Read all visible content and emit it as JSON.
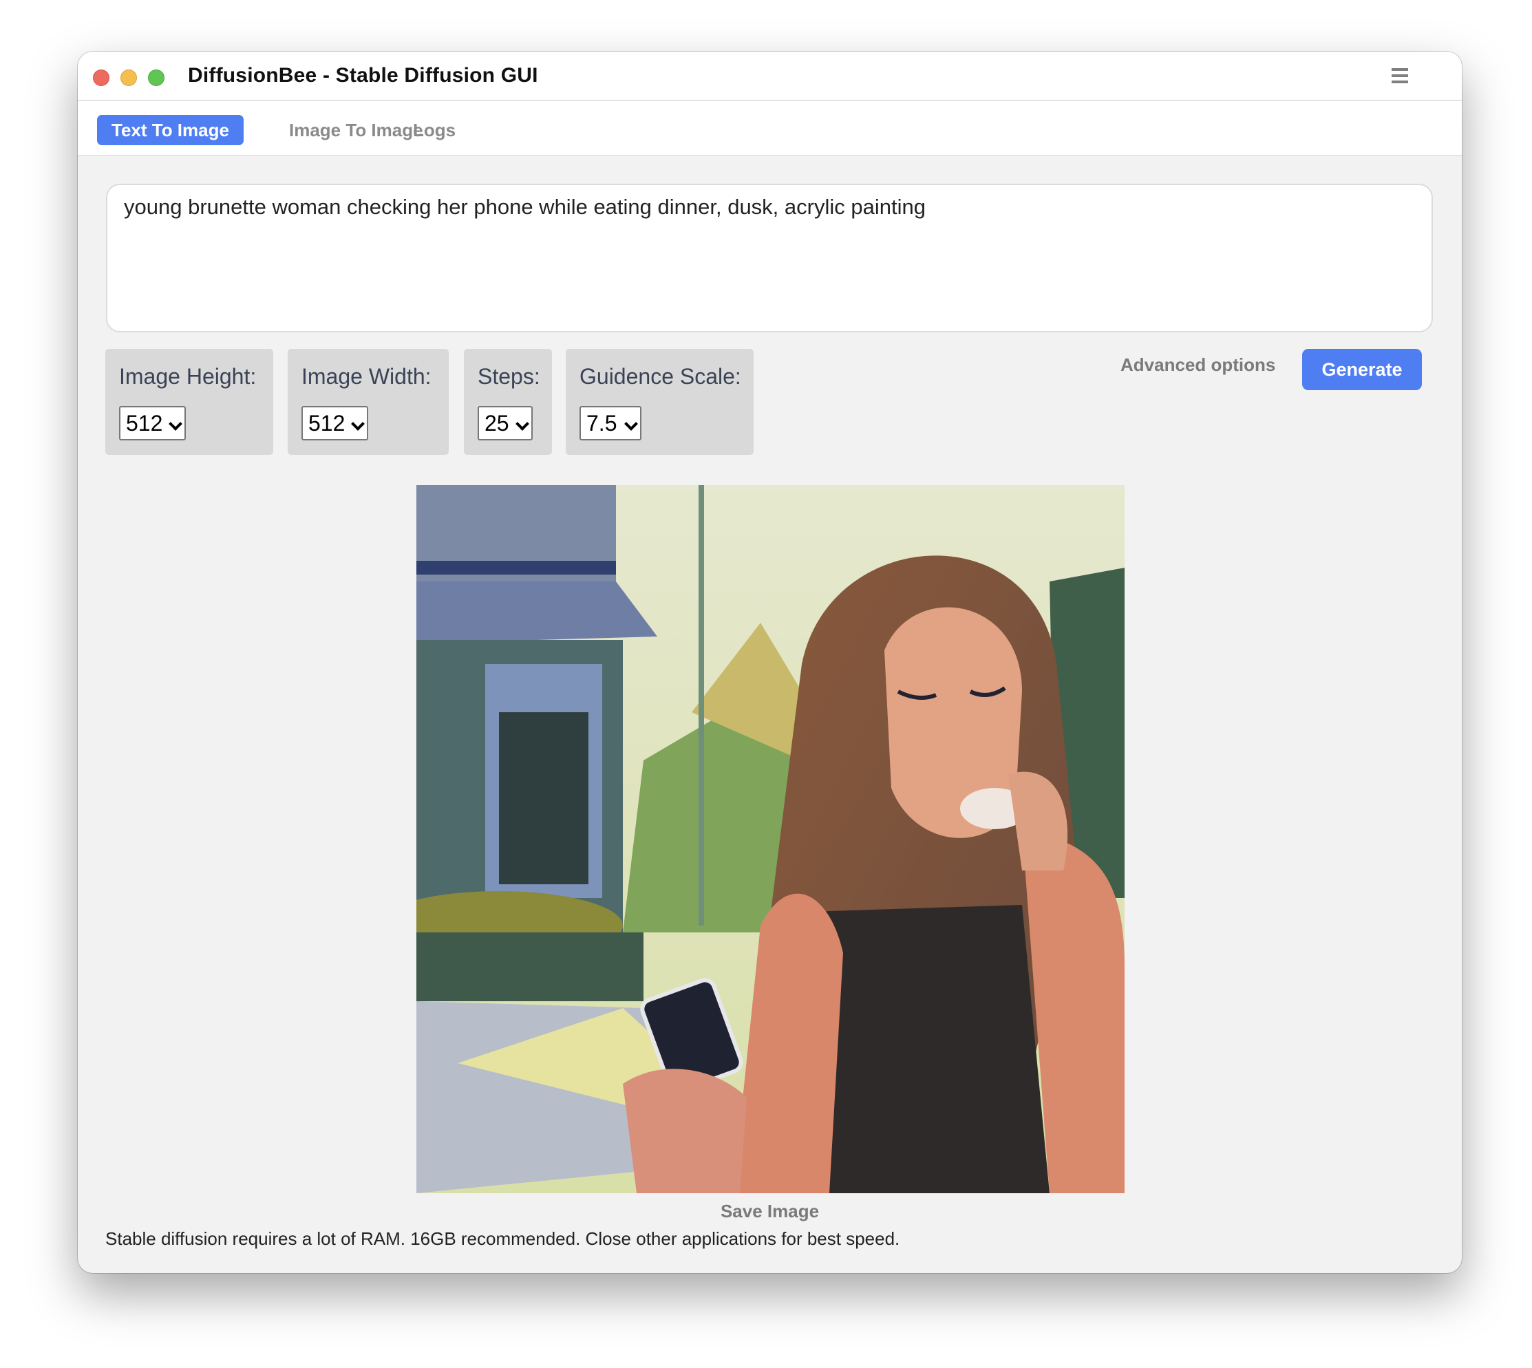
{
  "window": {
    "title": "DiffusionBee - Stable Diffusion GUI",
    "menu_icon": "hamburger-menu-icon"
  },
  "tabs": [
    {
      "label": "Text To Image",
      "active": true
    },
    {
      "label": "Image To Image",
      "active": false
    },
    {
      "label": "Logs",
      "active": false
    }
  ],
  "prompt": {
    "value": "young brunette woman checking her phone while eating dinner, dusk, acrylic painting"
  },
  "options": [
    {
      "label": "Image Height:",
      "value": "512"
    },
    {
      "label": "Image Width:",
      "value": "512"
    },
    {
      "label": "Steps:",
      "value": "25"
    },
    {
      "label": "Guidence Scale:",
      "value": "7.5"
    }
  ],
  "actions": {
    "advanced_options": "Advanced options",
    "generate": "Generate",
    "save_image": "Save Image"
  },
  "generated_image": {
    "description": "Acrylic painting of a young brunette woman eating and holding a phone at dusk"
  },
  "footer": {
    "notice": "Stable diffusion requires a lot of RAM. 16GB recommended. Close other applications for best speed."
  },
  "colors": {
    "accent": "#4f7ef2",
    "close": "#ec6a5e",
    "minimize": "#f5bf4f",
    "maximize": "#61c554"
  }
}
